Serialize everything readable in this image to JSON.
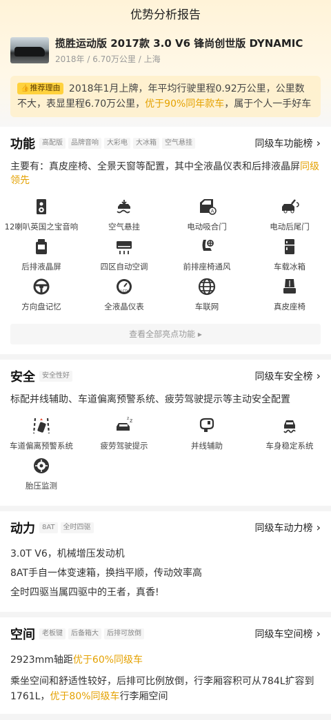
{
  "page_title": "优势分析报告",
  "car": {
    "name": "揽胜运动版 2017款 3.0 V6 锋尚创世版 DYNAMIC",
    "meta": "2018年 / 6.70万公里 / 上海"
  },
  "reason": {
    "tag": "推荐理由",
    "text_a": "2018年1月上牌，年平均行驶里程0.92万公里，公里数不大，表显里程6.70万公里，",
    "highlight": "优于90%同年款车",
    "text_b": "，属于个人一手好车"
  },
  "features": {
    "title": "功能",
    "badges": [
      "高配版",
      "品牌音响",
      "大彩电",
      "大冰箱",
      "空气悬挂"
    ],
    "rank": "同级车功能榜",
    "desc_a": "主要有：真皮座椅、全景天窗等配置，其中全液晶仪表和后排液晶屏",
    "desc_hl": "同级领先",
    "items": [
      {
        "label": "12喇叭英国之宝音响",
        "icon": "speaker-icon"
      },
      {
        "label": "空气悬挂",
        "icon": "air-suspension-icon"
      },
      {
        "label": "电动吸合门",
        "icon": "car-door-icon"
      },
      {
        "label": "电动后尾门",
        "icon": "tailgate-icon"
      },
      {
        "label": "后排液晶屏",
        "icon": "rear-screen-icon"
      },
      {
        "label": "四区自动空调",
        "icon": "air-conditioner-icon"
      },
      {
        "label": "前排座椅通风",
        "icon": "seat-ventilation-icon"
      },
      {
        "label": "车载冰箱",
        "icon": "fridge-icon"
      },
      {
        "label": "方向盘记忆",
        "icon": "steering-wheel-icon"
      },
      {
        "label": "全液晶仪表",
        "icon": "lcd-gauge-icon"
      },
      {
        "label": "车联网",
        "icon": "globe-icon"
      },
      {
        "label": "真皮座椅",
        "icon": "leather-seat-icon"
      }
    ],
    "more": "查看全部亮点功能"
  },
  "safety": {
    "title": "安全",
    "badges": [
      "安全性好"
    ],
    "rank": "同级车安全榜",
    "desc": "标配并线辅助、车道偏离预警系统、疲劳驾驶提示等主动安全配置",
    "items": [
      {
        "label": "车道偏离预警系统",
        "icon": "lane-departure-icon"
      },
      {
        "label": "疲劳驾驶提示",
        "icon": "fatigue-alert-icon"
      },
      {
        "label": "并线辅助",
        "icon": "mirror-icon"
      },
      {
        "label": "车身稳定系统",
        "icon": "stability-icon"
      },
      {
        "label": "胎压监测",
        "icon": "tire-icon"
      }
    ]
  },
  "power": {
    "title": "动力",
    "badges": [
      "8AT",
      "全时四驱"
    ],
    "rank": "同级车动力榜",
    "lines": [
      "3.0T V6，机械增压发动机",
      "8AT手自一体变速箱，换挡平顺，传动效率高",
      "全时四驱当属四驱中的王者，真香!"
    ]
  },
  "space": {
    "title": "空间",
    "badges": [
      "老板键",
      "后备箱大",
      "后排可放倒"
    ],
    "rank": "同级车空间榜",
    "line1_a": "2923mm轴距",
    "line1_hl": "优于60%同级车",
    "line2_a": "乘坐空间和舒适性较好，后排可比例放倒，行李厢容积可从784L扩容到1761L，",
    "line2_hl": "优于80%同级车",
    "line2_b": "行李厢空间"
  },
  "colors": {
    "accent": "#e4a100",
    "tag": "#ffd23d",
    "icon": "#333333"
  }
}
